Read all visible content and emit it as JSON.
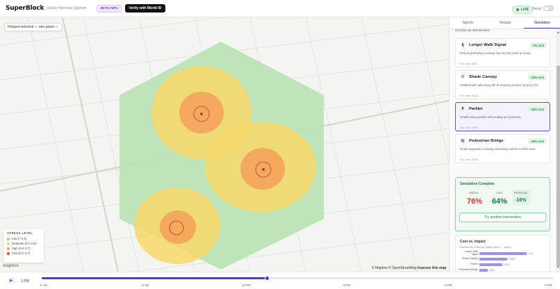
{
  "header": {
    "brand": "SuperBlock",
    "brand_sub": "Urban Nervous System",
    "chip": "ZETIC NPU",
    "verify": "Verify with World ID",
    "live": "LIVE",
    "demo": "Demo"
  },
  "map": {
    "tooltip": "Hotspot selected — see panel —",
    "attribution_a": "© Mapbox © OpenStreetMap",
    "attribution_b": "Improve this map",
    "logo": "mapbox",
    "legend": {
      "title": "STRESS LEVEL",
      "items": [
        {
          "label": "Low (< 0.3)",
          "color": "#a8dca8"
        },
        {
          "label": "Moderate (0.3–0.5)",
          "color": "#f7d86a"
        },
        {
          "label": "High (0.5–0.7)",
          "color": "#f5a35c"
        },
        {
          "label": "Critical (> 0.7)",
          "color": "#e05555"
        }
      ]
    }
  },
  "timeline": {
    "play_icon": "play-icon",
    "current_time": "1 PM",
    "progress": 0.44,
    "ticks": [
      "6 AM",
      "9 AM",
      "12 PM",
      "3 PM",
      "6 PM",
      "9 PM"
    ]
  },
  "panel": {
    "tabs": [
      "Agents",
      "Hotspot",
      "Simulation"
    ],
    "active_tab": 2,
    "choose_label": "Choose an intervention:",
    "cards": [
      {
        "icon": "walk-signal-icon",
        "icon_color": "#c0392b",
        "title": "Longer Walk Signal",
        "badge": "-7% ALS",
        "desc": "Extend pedestrian crossing time by 15s at 5th & Grand",
        "cost": "Est. cost: $5k"
      },
      {
        "icon": "canopy-icon",
        "icon_color": "#27ae60",
        "title": "Shade Canopy",
        "badge": "-10% ALS",
        "desc": "Install shade sails along 5th St reducing surface temp by 4°C",
        "cost": "Est. cost: $12k"
      },
      {
        "icon": "parklet-icon",
        "icon_color": "#a93226",
        "title": "Parklet",
        "badge": "-12% ALS",
        "desc": "Install resting parklet with seating and greenery",
        "cost": "Est. cost: $18k"
      },
      {
        "icon": "bridge-icon",
        "icon_color": "#8e44ad",
        "title": "Pedestrian Bridge",
        "badge": "-18% ALS",
        "desc": "Grade-separated crossing eliminating vehicle conflict zone",
        "cost": "Est. cost: $75k"
      }
    ],
    "simulation": {
      "title": "Simulation Complete",
      "before_label": "Before",
      "before": "76%",
      "after_label": "After",
      "after": "64%",
      "reduction_label": "Reduction",
      "reduction": "-16%",
      "button": "Try another intervention"
    },
    "cost_chart": {
      "title": "Cost vs. Impact",
      "subtitle": "Ranked by relief per dollar (best → worst)",
      "bars": [
        {
          "label": "Longer Walk Signal",
          "value": 1.4,
          "value_text": "1.4x"
        },
        {
          "label": "Shade Canopy",
          "value": 0.83,
          "value_text": "0.83x"
        },
        {
          "label": "Parklet",
          "value": 0.67,
          "value_text": "0.67x"
        },
        {
          "label": "Pedestrian Bridge",
          "value": 0.24,
          "value_text": "0.24x"
        }
      ]
    }
  }
}
